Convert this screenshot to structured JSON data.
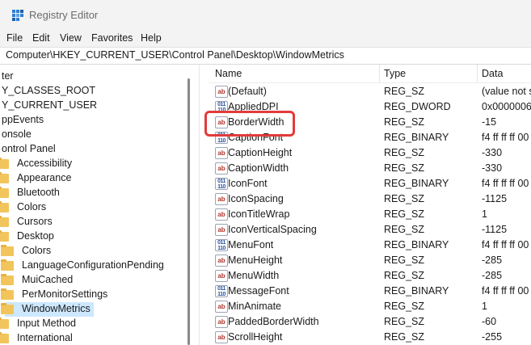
{
  "window": {
    "title": "Registry Editor"
  },
  "menu": [
    "File",
    "Edit",
    "View",
    "Favorites",
    "Help"
  ],
  "address": "Computer\\HKEY_CURRENT_USER\\Control Panel\\Desktop\\WindowMetrics",
  "tree": [
    {
      "label": "ter",
      "folder": false
    },
    {
      "label": "Y_CLASSES_ROOT",
      "folder": false
    },
    {
      "label": "Y_CURRENT_USER",
      "folder": false
    },
    {
      "label": "ppEvents",
      "folder": false
    },
    {
      "label": "onsole",
      "folder": false
    },
    {
      "label": "ontrol Panel",
      "folder": false
    },
    {
      "label": "Accessibility",
      "folder": true
    },
    {
      "label": "Appearance",
      "folder": true
    },
    {
      "label": "Bluetooth",
      "folder": true
    },
    {
      "label": "Colors",
      "folder": true
    },
    {
      "label": "Cursors",
      "folder": true
    },
    {
      "label": "Desktop",
      "folder": true
    },
    {
      "label": "Colors",
      "folder": true
    },
    {
      "label": "LanguageConfigurationPending",
      "folder": true
    },
    {
      "label": "MuiCached",
      "folder": true
    },
    {
      "label": "PerMonitorSettings",
      "folder": true
    },
    {
      "label": "WindowMetrics",
      "folder": true,
      "selected": true
    },
    {
      "label": "Input Method",
      "folder": true
    },
    {
      "label": "International",
      "folder": true
    }
  ],
  "columns": {
    "name": "Name",
    "type": "Type",
    "data": "Data"
  },
  "values": [
    {
      "icon": "string",
      "name": "(Default)",
      "type": "REG_SZ",
      "data": "(value not se"
    },
    {
      "icon": "binary",
      "name": "AppliedDPI",
      "type": "REG_DWORD",
      "data": "0x00000060"
    },
    {
      "icon": "string",
      "name": "BorderWidth",
      "type": "REG_SZ",
      "data": "-15"
    },
    {
      "icon": "binary",
      "name": "CaptionFont",
      "type": "REG_BINARY",
      "data": "f4 ff ff ff 00 0"
    },
    {
      "icon": "string",
      "name": "CaptionHeight",
      "type": "REG_SZ",
      "data": "-330"
    },
    {
      "icon": "string",
      "name": "CaptionWidth",
      "type": "REG_SZ",
      "data": "-330"
    },
    {
      "icon": "binary",
      "name": "IconFont",
      "type": "REG_BINARY",
      "data": "f4 ff ff ff 00 0"
    },
    {
      "icon": "string",
      "name": "IconSpacing",
      "type": "REG_SZ",
      "data": "-1125"
    },
    {
      "icon": "string",
      "name": "IconTitleWrap",
      "type": "REG_SZ",
      "data": "1"
    },
    {
      "icon": "string",
      "name": "IconVerticalSpacing",
      "type": "REG_SZ",
      "data": "-1125"
    },
    {
      "icon": "binary",
      "name": "MenuFont",
      "type": "REG_BINARY",
      "data": "f4 ff ff ff 00 0"
    },
    {
      "icon": "string",
      "name": "MenuHeight",
      "type": "REG_SZ",
      "data": "-285"
    },
    {
      "icon": "string",
      "name": "MenuWidth",
      "type": "REG_SZ",
      "data": "-285"
    },
    {
      "icon": "binary",
      "name": "MessageFont",
      "type": "REG_BINARY",
      "data": "f4 ff ff ff 00 0"
    },
    {
      "icon": "string",
      "name": "MinAnimate",
      "type": "REG_SZ",
      "data": "1"
    },
    {
      "icon": "string",
      "name": "PaddedBorderWidth",
      "type": "REG_SZ",
      "data": "-60"
    },
    {
      "icon": "string",
      "name": "ScrollHeight",
      "type": "REG_SZ",
      "data": "-255"
    }
  ],
  "colors": {
    "highlight": "#e23b3b",
    "selection": "#cde8ff",
    "folder": "#f2c55c"
  }
}
